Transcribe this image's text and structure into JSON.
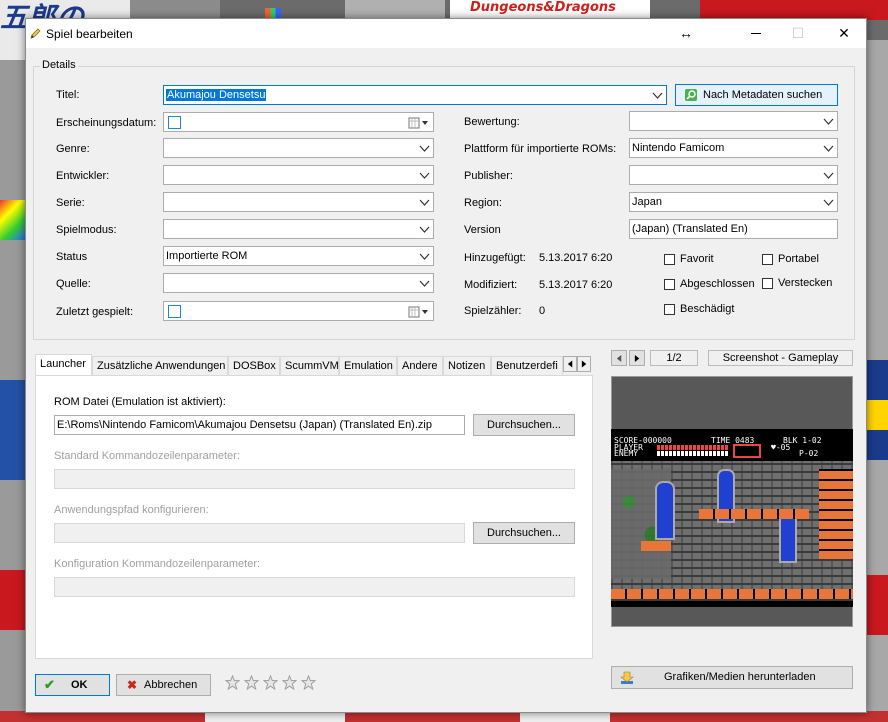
{
  "background": {
    "top_text": "Dungeons&Dragons",
    "japanese_text": "五郎の"
  },
  "window": {
    "title": "Spiel bearbeiten",
    "controls": {
      "move": "↔",
      "maximize": "☐",
      "close": "✕"
    }
  },
  "details": {
    "group_label": "Details",
    "title_label": "Titel:",
    "title_value": "Akumajou Densetsu",
    "metadata_button": "Nach Metadaten suchen",
    "release_label": "Erscheinungsdatum:",
    "genre_label": "Genre:",
    "developer_label": "Entwickler:",
    "series_label": "Serie:",
    "playmode_label": "Spielmodus:",
    "status_label": "Status",
    "status_value": "Importierte ROM",
    "source_label": "Quelle:",
    "lastplayed_label": "Zuletzt gespielt:",
    "rating_label": "Bewertung:",
    "platform_label": "Plattform für importierte ROMs:",
    "platform_value": "Nintendo Famicom",
    "publisher_label": "Publisher:",
    "region_label": "Region:",
    "region_value": "Japan",
    "version_label": "Version",
    "version_value": "(Japan) (Translated En)",
    "added_label": "Hinzugefügt:",
    "added_value": "5.13.2017 6:20",
    "modified_label": "Modifiziert:",
    "modified_value": "5.13.2017 6:20",
    "playcount_label": "Spielzähler:",
    "playcount_value": "0",
    "checkboxes": {
      "favorite": "Favorit",
      "portable": "Portabel",
      "completed": "Abgeschlossen",
      "hide": "Verstecken",
      "broken": "Beschädigt"
    }
  },
  "tabs": [
    "Launcher",
    "Zusätzliche Anwendungen",
    "DOSBox",
    "ScummVM",
    "Emulation",
    "Andere",
    "Notizen",
    "Benutzerdefi"
  ],
  "launcher": {
    "rom_label": "ROM Datei (Emulation ist aktiviert):",
    "rom_value": "E:\\Roms\\Nintendo Famicom\\Akumajou Densetsu (Japan) (Translated En).zip",
    "browse": "Durchsuchen...",
    "cmdline_label": "Standard Kommandozeilenparameter:",
    "apppath_label": "Anwendungspfad konfigurieren:",
    "config_cmd_label": "Konfiguration Kommandozeilenparameter:"
  },
  "media": {
    "page": "1/2",
    "media_type": "Screenshot - Gameplay",
    "download_button": "Grafiken/Medien herunterladen",
    "game_hud": {
      "score": "SCORE-000000",
      "time": "TIME 0483",
      "block": "BLK 1-02",
      "player": "PLAYER",
      "enemy": "ENEMY",
      "hearts": "♥-05",
      "p": "P-02"
    }
  },
  "footer": {
    "ok": "OK",
    "cancel": "Abbrechen",
    "stars": 0
  },
  "colors": {
    "accent": "#0078d7",
    "green_check": "#2a9d2a",
    "red_x": "#c42b1c"
  }
}
